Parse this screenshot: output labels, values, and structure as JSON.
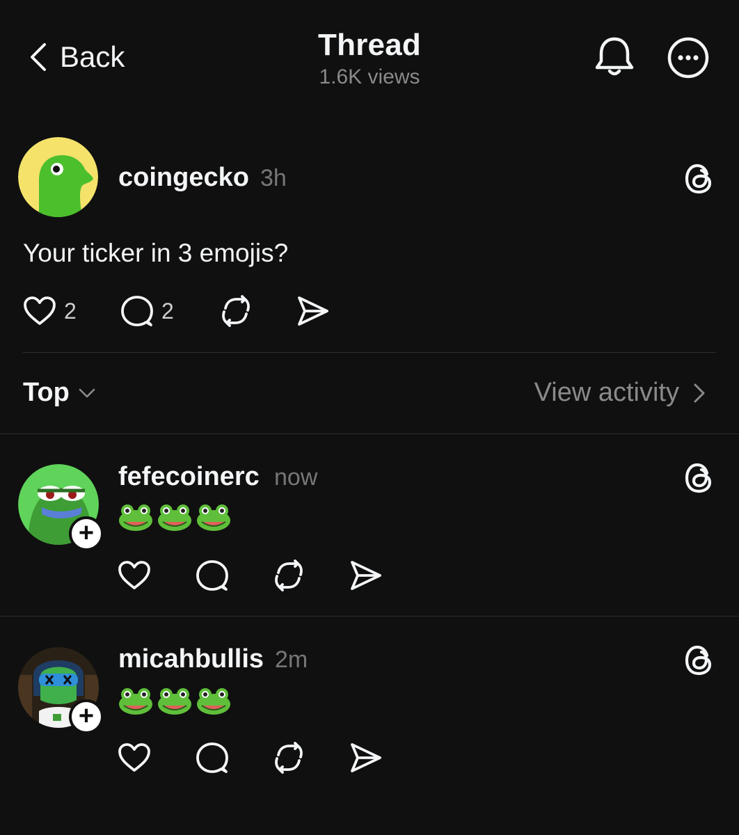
{
  "header": {
    "back_label": "Back",
    "title": "Thread",
    "views": "1.6K views",
    "icons": [
      "bell-icon",
      "more-options-icon"
    ]
  },
  "post": {
    "username": "coingecko",
    "time": "3h",
    "text": "Your ticker in 3 emojis?",
    "likes": "2",
    "replies": "2"
  },
  "sort": {
    "label": "Top",
    "view_activity": "View activity"
  },
  "replies": [
    {
      "username": "fefecoinerc",
      "time": "now",
      "emojis": [
        "frog",
        "frog",
        "frog"
      ]
    },
    {
      "username": "micahbullis",
      "time": "2m",
      "emojis": [
        "frog",
        "frog",
        "frog"
      ]
    }
  ],
  "colors": {
    "background": "#101010",
    "text_primary": "#f3f5f7",
    "text_secondary": "#777777",
    "divider": "#2e2e2e",
    "gecko_green": "#4cbf2d",
    "gecko_yellow": "#f4e26b"
  }
}
